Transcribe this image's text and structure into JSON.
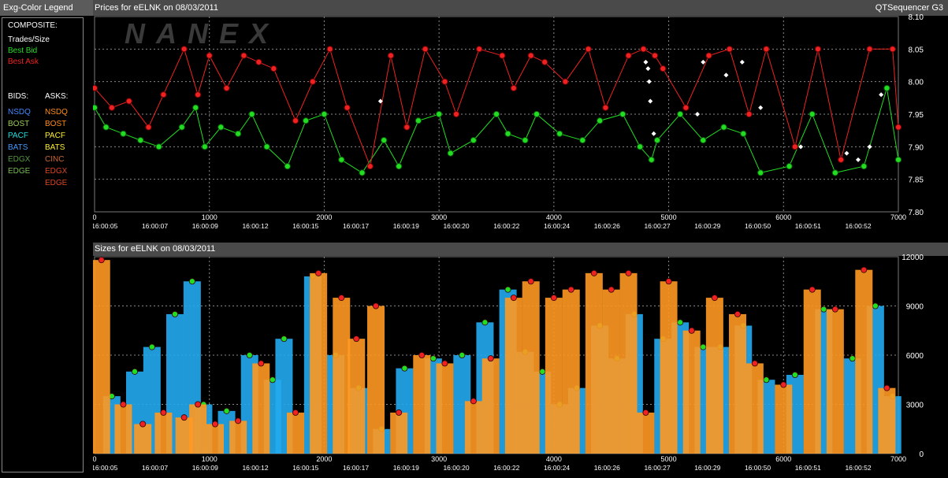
{
  "legend": {
    "title": "Exg-Color Legend",
    "composite_header": "COMPOSITE:",
    "composite": [
      {
        "label": "Trades/Size",
        "color": "#ffffff"
      },
      {
        "label": "Best Bid",
        "color": "#22dd22"
      },
      {
        "label": "Best Ask",
        "color": "#ee2222"
      }
    ],
    "bids_header": "BIDS:",
    "asks_header": "ASKS:",
    "bids": [
      {
        "label": "NSDQ",
        "color": "#4488ff"
      },
      {
        "label": "BOST",
        "color": "#99cc55"
      },
      {
        "label": "PACF",
        "color": "#22dddd"
      },
      {
        "label": "BATS",
        "color": "#4499ff"
      },
      {
        "label": "EDGX",
        "color": "#559944"
      },
      {
        "label": "EDGE",
        "color": "#77bb55"
      }
    ],
    "asks": [
      {
        "label": "NSDQ",
        "color": "#ff8c1a"
      },
      {
        "label": "BOST",
        "color": "#ff8c1a"
      },
      {
        "label": "PACF",
        "color": "#ffee33"
      },
      {
        "label": "BATS",
        "color": "#ffee33"
      },
      {
        "label": "CINC",
        "color": "#cc6633"
      },
      {
        "label": "EDGX",
        "color": "#dd4422"
      },
      {
        "label": "EDGE",
        "color": "#dd4422"
      }
    ]
  },
  "header": {
    "prices_title": "Prices for  eELNK  on  08/03/2011",
    "app_name": "QTSequencer G3",
    "sizes_title": "Sizes for  eELNK  on  08/03/2011",
    "watermark": "NANEX"
  },
  "chart_data": [
    {
      "type": "line",
      "title": "Prices for  eELNK  on  08/03/2011",
      "x_ticks": [
        "0",
        "1000",
        "2000",
        "3000",
        "4000",
        "5000",
        "6000",
        "7000"
      ],
      "xlim": [
        0,
        7000
      ],
      "time_labels": [
        "16:00:05",
        "16:00:07",
        "16:00:09",
        "16:00:12",
        "16:00:15",
        "16:00:17",
        "16:00:19",
        "16:00:20",
        "16:00:22",
        "16:00:24",
        "16:00:26",
        "16:00:27",
        "16:00:29",
        "16:00:50",
        "16:00:51",
        "16:00:52"
      ],
      "y_ticks": [
        "8.10",
        "8.05",
        "8.00",
        "7.95",
        "7.90",
        "7.85",
        "7.80"
      ],
      "ylim": [
        7.8,
        8.1
      ],
      "grid": true,
      "series": [
        {
          "name": "Best Bid",
          "color": "#22dd22",
          "role": "bid",
          "x": [
            0,
            100,
            250,
            400,
            560,
            760,
            880,
            960,
            1100,
            1250,
            1370,
            1500,
            1680,
            1840,
            2000,
            2150,
            2330,
            2520,
            2650,
            2820,
            3000,
            3100,
            3300,
            3500,
            3600,
            3750,
            3850,
            4050,
            4250,
            4400,
            4600,
            4750,
            4850,
            4900,
            5100,
            5300,
            5480,
            5650,
            5800,
            6050,
            6250,
            6450,
            6700,
            6900,
            7000
          ],
          "y": [
            7.96,
            7.93,
            7.92,
            7.91,
            7.9,
            7.93,
            7.96,
            7.9,
            7.93,
            7.92,
            7.95,
            7.9,
            7.87,
            7.94,
            7.95,
            7.88,
            7.86,
            7.91,
            7.87,
            7.94,
            7.95,
            7.89,
            7.91,
            7.95,
            7.92,
            7.91,
            7.95,
            7.92,
            7.91,
            7.94,
            7.95,
            7.9,
            7.88,
            7.91,
            7.95,
            7.91,
            7.93,
            7.92,
            7.86,
            7.87,
            7.95,
            7.86,
            7.87,
            7.99,
            7.88
          ]
        },
        {
          "name": "Best Ask",
          "color": "#ee2222",
          "role": "ask",
          "x": [
            0,
            150,
            300,
            470,
            600,
            780,
            900,
            1000,
            1150,
            1300,
            1430,
            1560,
            1750,
            1900,
            2050,
            2200,
            2400,
            2580,
            2720,
            2880,
            3050,
            3150,
            3350,
            3550,
            3650,
            3800,
            3920,
            4100,
            4300,
            4450,
            4650,
            4780,
            4880,
            4950,
            5150,
            5350,
            5530,
            5700,
            5850,
            6100,
            6300,
            6500,
            6750,
            6950,
            7000
          ],
          "y": [
            7.99,
            7.96,
            7.97,
            7.93,
            7.98,
            8.05,
            7.98,
            8.04,
            7.99,
            8.04,
            8.03,
            8.02,
            7.94,
            8.0,
            8.05,
            7.96,
            7.87,
            8.04,
            7.93,
            8.05,
            8.0,
            7.95,
            8.05,
            8.04,
            7.99,
            8.04,
            8.03,
            8.0,
            8.05,
            7.96,
            8.04,
            8.05,
            8.04,
            8.02,
            7.96,
            8.04,
            8.05,
            7.95,
            8.05,
            7.9,
            8.05,
            7.88,
            8.05,
            8.05,
            7.93
          ]
        },
        {
          "name": "Trades",
          "color": "#ffffff",
          "role": "trade",
          "x": [
            2490,
            4800,
            4820,
            4830,
            4840,
            4870,
            5250,
            5300,
            5500,
            5640,
            5800,
            6150,
            6550,
            6650,
            6750,
            6850
          ],
          "y": [
            7.97,
            8.03,
            8.02,
            8.0,
            7.97,
            7.92,
            7.95,
            8.03,
            8.01,
            8.03,
            7.96,
            7.9,
            7.89,
            7.88,
            7.9,
            7.98
          ]
        }
      ]
    },
    {
      "type": "bar",
      "title": "Sizes for  eELNK  on  08/03/2011",
      "x_ticks": [
        "0",
        "1000",
        "2000",
        "3000",
        "4000",
        "5000",
        "6000",
        "7000"
      ],
      "xlim": [
        0,
        7000
      ],
      "time_labels": [
        "16:00:05",
        "16:00:07",
        "16:00:09",
        "16:00:12",
        "16:00:15",
        "16:00:17",
        "16:00:19",
        "16:00:20",
        "16:00:22",
        "16:00:24",
        "16:00:26",
        "16:00:27",
        "16:00:29",
        "16:00:50",
        "16:00:51",
        "16:00:52"
      ],
      "y_ticks": [
        "12000",
        "9000",
        "6000",
        "3000",
        "0"
      ],
      "ylim": [
        0,
        12000
      ],
      "grid": true,
      "series": [
        {
          "name": "Bid Size",
          "color": "#22aaee",
          "x": [
            150,
            350,
            500,
            700,
            850,
            950,
            1150,
            1350,
            1550,
            1650,
            1900,
            2100,
            2300,
            2500,
            2700,
            2950,
            3200,
            3400,
            3600,
            3750,
            3900,
            4050,
            4200,
            4400,
            4550,
            4700,
            4950,
            5100,
            5300,
            5450,
            5650,
            5850,
            6100,
            6350,
            6600,
            6800,
            6950
          ],
          "values": [
            3500,
            5000,
            6500,
            8500,
            10500,
            3000,
            2600,
            6000,
            4500,
            7000,
            10800,
            6000,
            4000,
            1500,
            5200,
            5800,
            6000,
            8000,
            10000,
            6200,
            5000,
            3000,
            4000,
            7800,
            5800,
            8500,
            7000,
            8000,
            6500,
            6500,
            7800,
            4500,
            4800,
            8800,
            5800,
            9000,
            3500
          ]
        },
        {
          "name": "Ask Size",
          "color": "#ff9922",
          "x": [
            60,
            250,
            420,
            600,
            780,
            900,
            1050,
            1250,
            1450,
            1750,
            1950,
            2150,
            2280,
            2450,
            2650,
            2850,
            3050,
            3300,
            3450,
            3650,
            3800,
            4000,
            4150,
            4350,
            4500,
            4650,
            4800,
            5000,
            5200,
            5400,
            5600,
            5750,
            6000,
            6250,
            6450,
            6700,
            6900
          ],
          "values": [
            11800,
            3000,
            1800,
            2500,
            2200,
            3000,
            1800,
            2000,
            5500,
            2500,
            11000,
            9500,
            7000,
            9000,
            2500,
            6000,
            5500,
            3200,
            5800,
            9500,
            10500,
            9500,
            10000,
            11000,
            10000,
            11000,
            2500,
            10500,
            7500,
            9500,
            8500,
            5500,
            4200,
            10000,
            8800,
            11200,
            4000
          ]
        }
      ]
    }
  ]
}
